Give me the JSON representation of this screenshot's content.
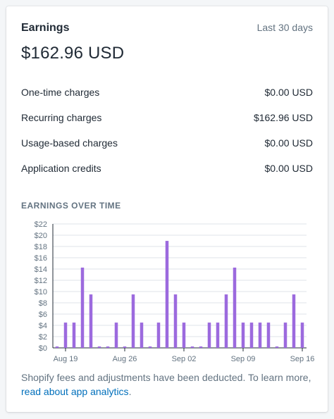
{
  "card": {
    "title": "Earnings",
    "period": "Last 30 days",
    "total": "$162.96 USD"
  },
  "breakdown": [
    {
      "label": "One-time charges",
      "value": "$0.00 USD"
    },
    {
      "label": "Recurring charges",
      "value": "$162.96 USD"
    },
    {
      "label": "Usage-based charges",
      "value": "$0.00 USD"
    },
    {
      "label": "Application credits",
      "value": "$0.00 USD"
    }
  ],
  "section_title": "EARNINGS OVER TIME",
  "footer": {
    "text": "Shopify fees and adjustments have been deducted. To learn more,",
    "link": "read about app analytics",
    "after_link": "."
  },
  "colors": {
    "bar": "#9c6ade",
    "gridline": "#dfe3e8",
    "axis": "#212b36"
  },
  "chart_data": {
    "type": "bar",
    "title": "EARNINGS OVER TIME",
    "xlabel": "",
    "ylabel": "",
    "ylim": [
      0,
      22
    ],
    "yticks": [
      "$0",
      "$2",
      "$4",
      "$6",
      "$8",
      "$10",
      "$12",
      "$14",
      "$16",
      "$18",
      "$20",
      "$22"
    ],
    "xtick_labels": [
      {
        "label": "Aug 19",
        "index": 1
      },
      {
        "label": "Aug 26",
        "index": 8
      },
      {
        "label": "Sep 02",
        "index": 15
      },
      {
        "label": "Sep 09",
        "index": 22
      },
      {
        "label": "Sep 16",
        "index": 29
      }
    ],
    "grid": true,
    "values": [
      0.25,
      4.49,
      4.49,
      14.25,
      9.49,
      0.25,
      0.25,
      4.49,
      0.25,
      9.49,
      4.49,
      0.25,
      4.49,
      18.99,
      9.49,
      4.49,
      0.25,
      0.25,
      4.49,
      4.49,
      9.49,
      14.25,
      4.49,
      4.49,
      4.49,
      4.49,
      0.25,
      4.49,
      9.49,
      4.49
    ]
  }
}
